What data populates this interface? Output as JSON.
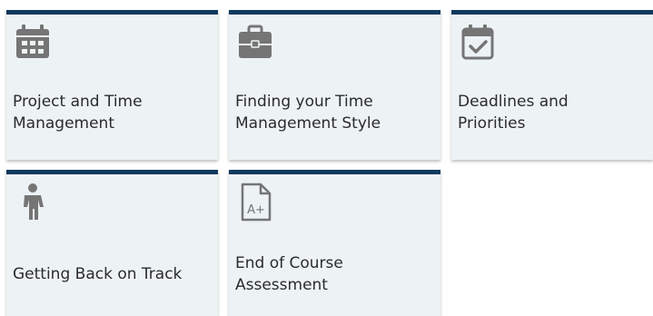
{
  "colors": {
    "tile_background": "#edf3f5",
    "tile_top_bar": "#0e3a5f",
    "icon": "#757575",
    "text": "#2b2b2b"
  },
  "tiles": [
    {
      "label": "Project and Time\nManagement",
      "icon": "calendar-icon"
    },
    {
      "label": "Finding your Time\nManagement Style",
      "icon": "briefcase-icon"
    },
    {
      "label": "Deadlines and\nPriorities",
      "icon": "calendar-check-icon"
    },
    {
      "label": "Getting Back on Track",
      "icon": "child-icon"
    },
    {
      "label": "End of Course\nAssessment",
      "icon": "graded-document-icon"
    }
  ],
  "icons": {
    "assessment_grade": "A+"
  }
}
